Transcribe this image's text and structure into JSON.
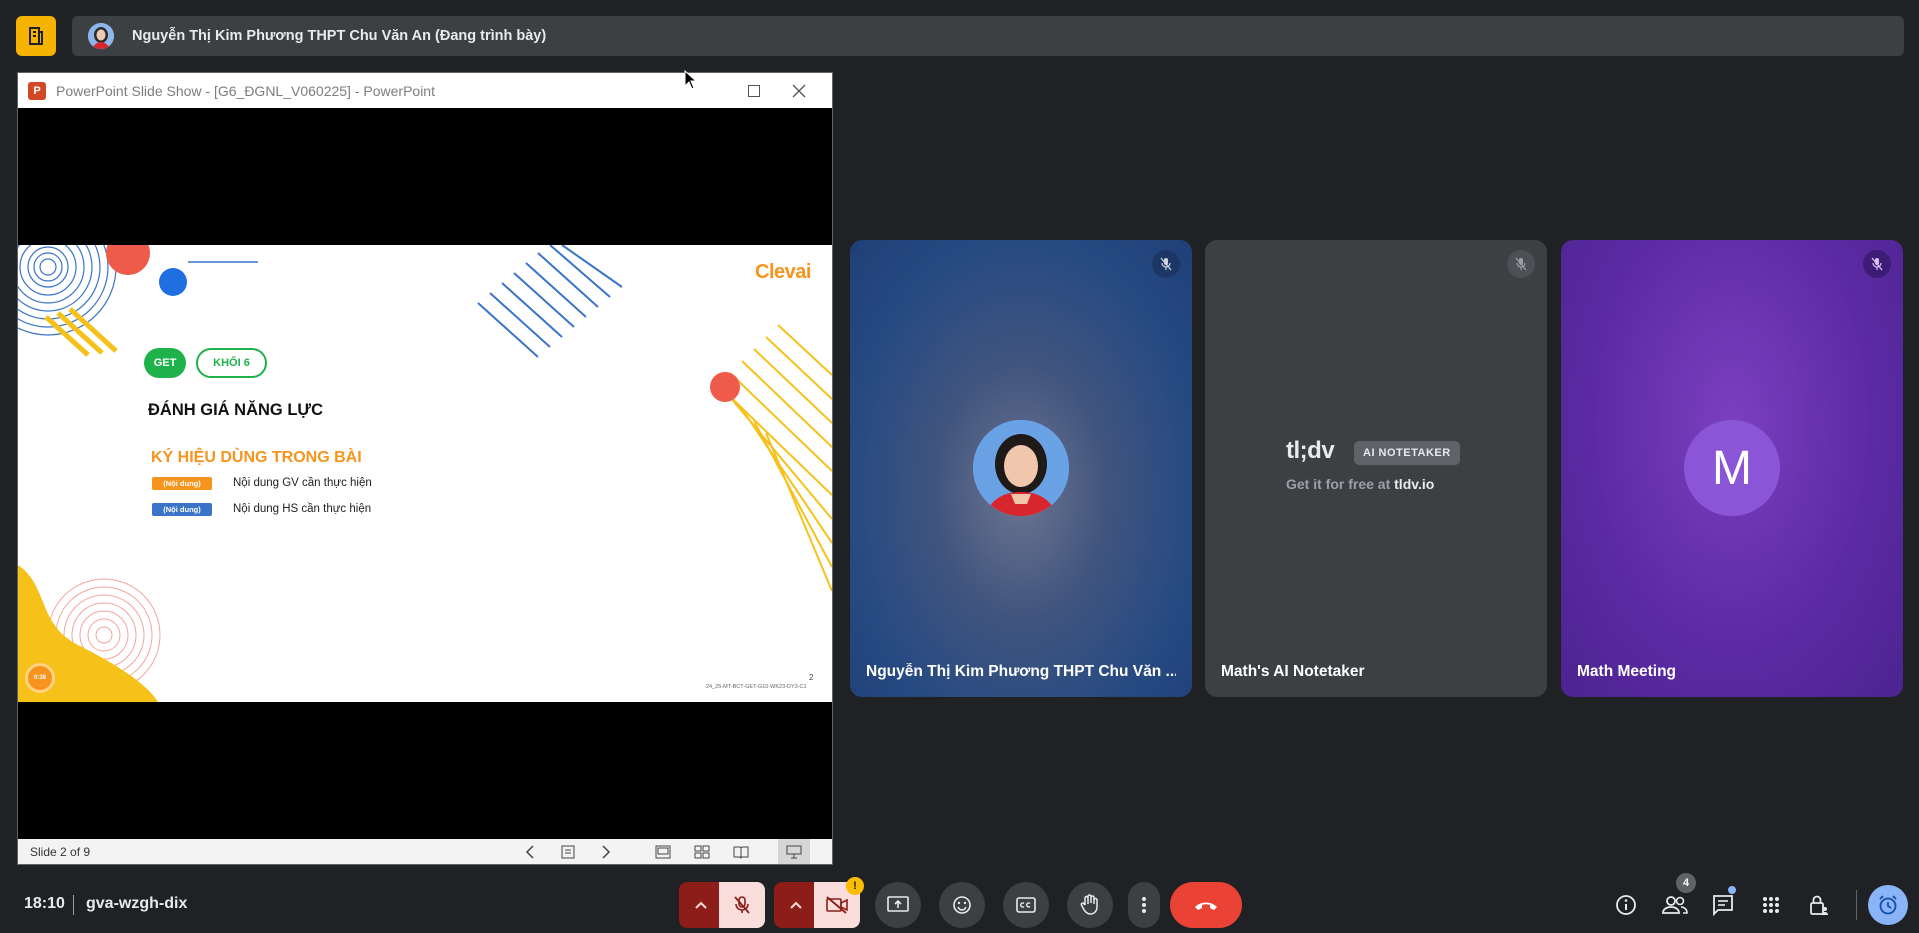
{
  "presenter_bar": {
    "name": "Nguyễn Thị Kim Phương THPT Chu Văn An (Đang trình bày)"
  },
  "ppt_window": {
    "title": "PowerPoint Slide Show - [G6_ĐGNL_V060225] - PowerPoint",
    "status": "Slide 2 of 9",
    "icons": [
      "prev-icon",
      "notes-icon",
      "next-icon",
      "normal-view-icon",
      "slide-sorter-icon",
      "reading-view-icon",
      "slideshow-view-icon"
    ]
  },
  "slide": {
    "brand": "Clevai",
    "pill_get": "GET",
    "pill_grade": "KHỐI 6",
    "heading": "ĐÁNH GIÁ NĂNG LỰC",
    "subheading": "KÝ HIỆU DÙNG TRONG BÀI",
    "legend": [
      {
        "tag": "(Nội dung)",
        "text": "Nội dung GV cần thực hiện",
        "color": "#f7941d"
      },
      {
        "tag": "(Nội dung)",
        "text": "Nội dung HS cần thực hiện",
        "color": "#3a74c8"
      }
    ],
    "page_number": "2",
    "code": "24_25-MT-BCT-GET-G10-WK23-DY3-C1",
    "timer": "0:38"
  },
  "tiles": [
    {
      "name": "Nguyễn Thị Kim Phương THPT Chu Văn ...",
      "mic": "muted"
    },
    {
      "name": "Math's AI Notetaker",
      "mic": "muted",
      "logo": "tl;dv",
      "badge": "AI NOTETAKER",
      "sub_prefix": "Get it for free at ",
      "sub_link": "tldv.io"
    },
    {
      "name": "Math Meeting",
      "mic": "muted",
      "initial": "M"
    }
  ],
  "bottom": {
    "time": "18:10",
    "code": "gva-wzgh-dix",
    "warning": "!",
    "people_count": "4"
  },
  "colors": {
    "background": "#202124",
    "end_call": "#ea4335",
    "accent": "#8ab4f8",
    "brand_orange": "#f7941d",
    "brand_green": "#1fb24a"
  }
}
